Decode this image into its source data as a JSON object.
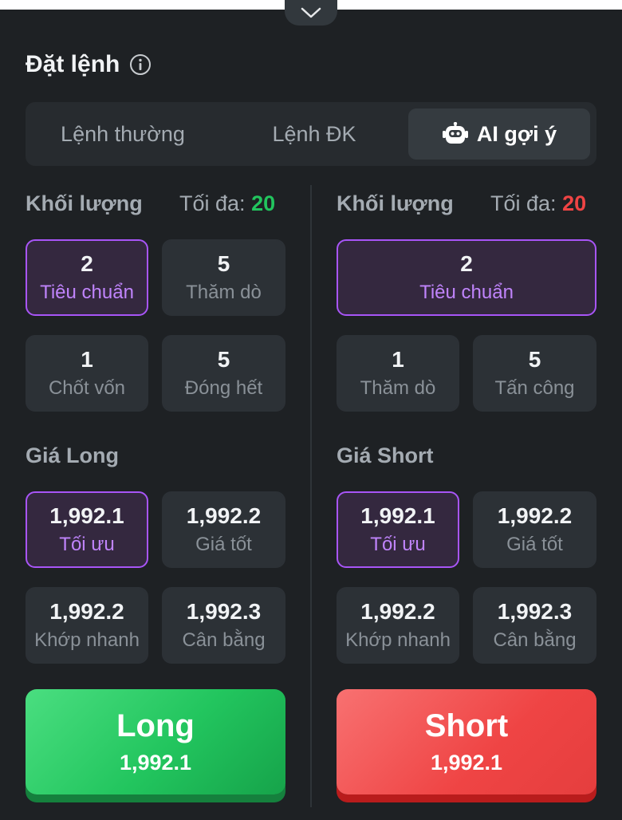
{
  "header": {
    "title": "Đặt lệnh"
  },
  "tabs": [
    {
      "label": "Lệnh thường"
    },
    {
      "label": "Lệnh ĐK"
    },
    {
      "label": "AI gợi ý",
      "active": true
    }
  ],
  "long": {
    "volume_label": "Khối lượng",
    "max_prefix": "Tối đa:",
    "max_value": "20",
    "volume_options": [
      {
        "value": "2",
        "label": "Tiêu chuẩn",
        "selected": true
      },
      {
        "value": "5",
        "label": "Thăm dò"
      },
      {
        "value": "1",
        "label": "Chốt vốn"
      },
      {
        "value": "5",
        "label": "Đóng hết"
      }
    ],
    "price_label": "Giá Long",
    "price_options": [
      {
        "value": "1,992.1",
        "label": "Tối ưu",
        "selected": true
      },
      {
        "value": "1,992.2",
        "label": "Giá tốt"
      },
      {
        "value": "1,992.2",
        "label": "Khớp nhanh"
      },
      {
        "value": "1,992.3",
        "label": "Cân bằng"
      }
    ],
    "button_label": "Long",
    "button_price": "1,992.1"
  },
  "short": {
    "volume_label": "Khối lượng",
    "max_prefix": "Tối đa:",
    "max_value": "20",
    "volume_options": [
      {
        "value": "2",
        "label": "Tiêu chuẩn",
        "selected": true
      },
      {
        "value": "1",
        "label": "Thăm dò"
      },
      {
        "value": "5",
        "label": "Tấn công"
      }
    ],
    "price_label": "Giá Short",
    "price_options": [
      {
        "value": "1,992.1",
        "label": "Tối ưu",
        "selected": true
      },
      {
        "value": "1,992.2",
        "label": "Giá tốt"
      },
      {
        "value": "1,992.2",
        "label": "Khớp nhanh"
      },
      {
        "value": "1,992.3",
        "label": "Cân bằng"
      }
    ],
    "button_label": "Short",
    "button_price": "1,992.1"
  },
  "colors": {
    "background": "#1e2124",
    "accent_selected": "#a855f7",
    "long_green": "#22c55e",
    "short_red": "#ef4444"
  },
  "icons": {
    "collapse": "chevron-down-icon",
    "info": "info-icon",
    "ai": "robot-icon"
  }
}
